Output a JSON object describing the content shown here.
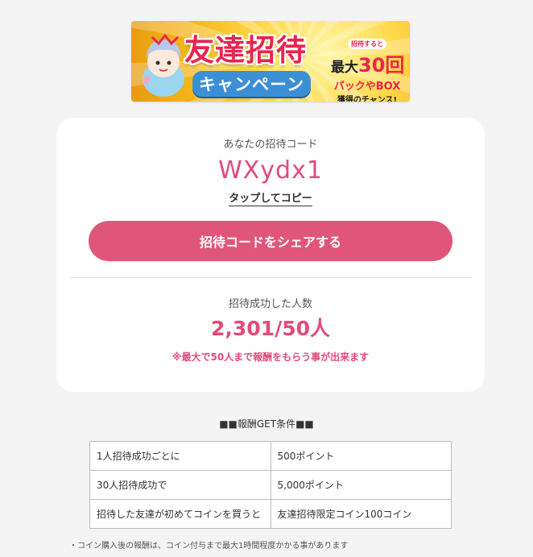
{
  "banner": {
    "title": "友達招待",
    "subtitle": "キャンペーン",
    "badge_small": "招待すると",
    "max_text": "最大",
    "max_count": "30回",
    "pack_text": "パックやBOX",
    "chance_text": "獲得のチャンス!"
  },
  "invite": {
    "code_label": "あなたの招待コード",
    "code_value": "WXydx1",
    "copy_label": "タップしてコピー",
    "share_button": "招待コードをシェアする"
  },
  "stats": {
    "count_label": "招待成功した人数",
    "count_value": "2,301/50人",
    "note": "※最大で50人まで報酬をもらう事が出来ます"
  },
  "conditions": {
    "title": "■■報酬GET条件■■",
    "rows": [
      {
        "condition": "1人招待成功ごとに",
        "reward": "500ポイント"
      },
      {
        "condition": "30人招待成功で",
        "reward": "5,000ポイント"
      },
      {
        "condition": "招待した友達が初めてコインを買うと",
        "reward": "友達招待限定コイン100コイン"
      }
    ]
  },
  "footnote": "・コイン購入後の報酬は、コイン付与まで最大1時間程度かかる事があります",
  "colors": {
    "accent": "#e14b78",
    "button": "#e0567a",
    "background": "#f4f4f4"
  }
}
